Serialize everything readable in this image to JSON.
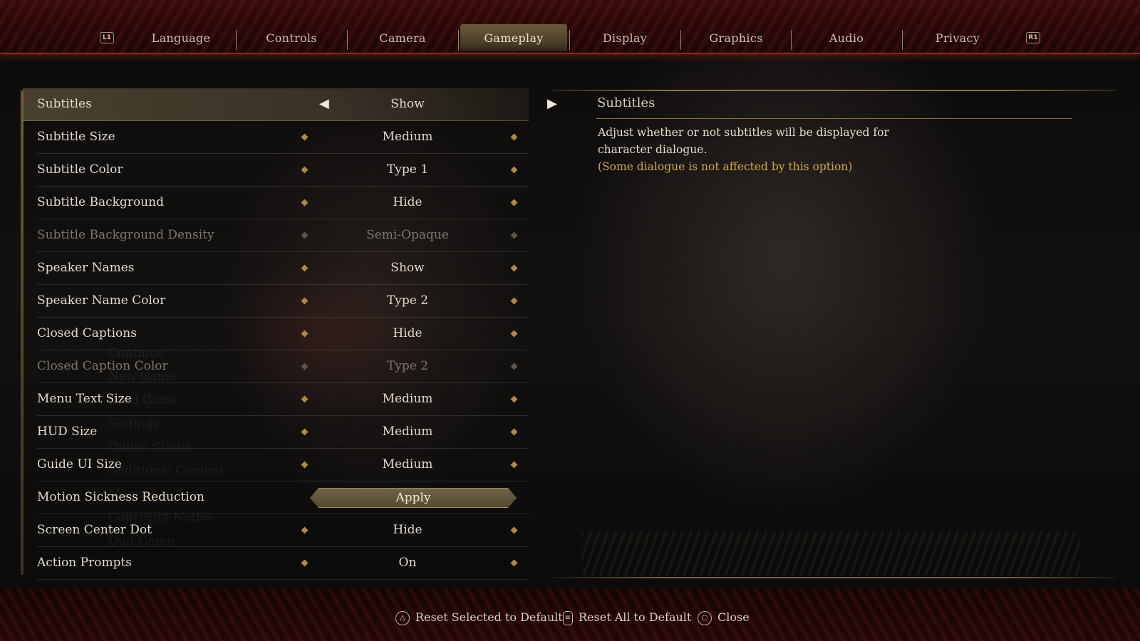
{
  "tabs": {
    "left_button": "L1",
    "right_button": "R1",
    "items": [
      "Language",
      "Controls",
      "Camera",
      "Gameplay",
      "Display",
      "Graphics",
      "Audio",
      "Privacy"
    ],
    "active": "Gameplay"
  },
  "settings": [
    {
      "label": "Subtitles",
      "value": "Show",
      "state": "selected"
    },
    {
      "label": "Subtitle Size",
      "value": "Medium"
    },
    {
      "label": "Subtitle Color",
      "value": "Type 1"
    },
    {
      "label": "Subtitle Background",
      "value": "Hide"
    },
    {
      "label": "Subtitle Background Density",
      "value": "Semi-Opaque",
      "state": "disabled"
    },
    {
      "label": "Speaker Names",
      "value": "Show"
    },
    {
      "label": "Speaker Name Color",
      "value": "Type 2"
    },
    {
      "label": "Closed Captions",
      "value": "Hide"
    },
    {
      "label": "Closed Caption Color",
      "value": "Type 2",
      "state": "disabled"
    },
    {
      "label": "Menu Text Size",
      "value": "Medium"
    },
    {
      "label": "HUD Size",
      "value": "Medium"
    },
    {
      "label": "Guide UI Size",
      "value": "Medium"
    },
    {
      "label": "Motion Sickness Reduction",
      "value": "Apply",
      "type": "button"
    },
    {
      "label": "Screen Center Dot",
      "value": "Hide"
    },
    {
      "label": "Action Prompts",
      "value": "On"
    }
  ],
  "description": {
    "title": "Subtitles",
    "body": "Adjust whether or not subtitles will be displayed for character dialogue.",
    "note": "(Some dialogue is not affected by this option)"
  },
  "background_menu": [
    "Continue",
    "New Game",
    "Load Game",
    "Settings",
    "Online Status",
    "Additional Content",
    "Manual",
    "Copyright Notice",
    "Quit Game"
  ],
  "footer": {
    "reset_selected": "Reset Selected to Default",
    "reset_all": "Reset All to Default",
    "close": "Close"
  },
  "colors": {
    "accent_gold": "#b08a45",
    "note_text": "#d6a84a",
    "bar_red": "#8a2a1c"
  }
}
